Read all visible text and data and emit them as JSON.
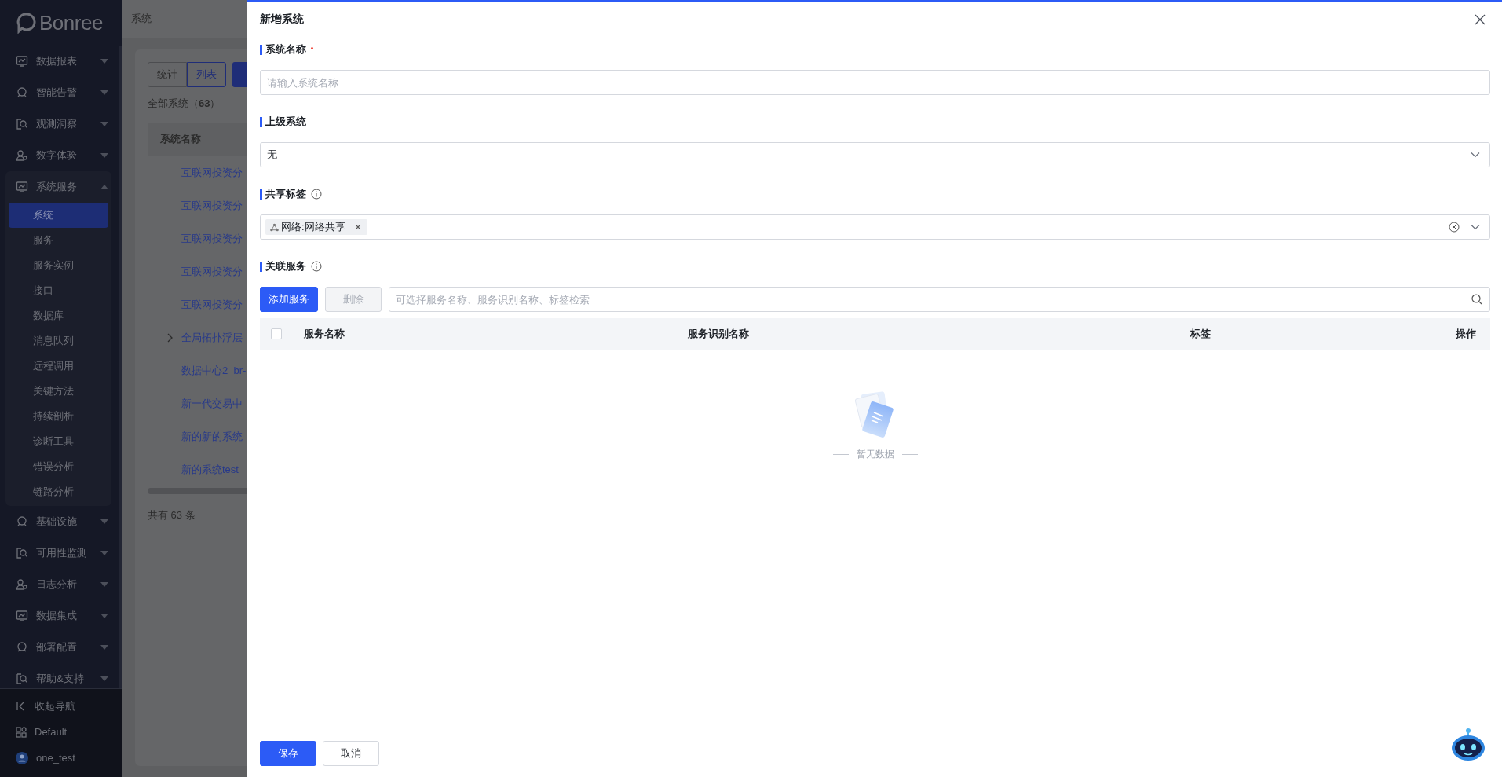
{
  "sidebar": {
    "logo": "Bonree",
    "menu": [
      {
        "label": "数据报表",
        "expanded": false
      },
      {
        "label": "智能告警",
        "expanded": false
      },
      {
        "label": "观测洞察",
        "expanded": false
      },
      {
        "label": "数字体验",
        "expanded": false
      },
      {
        "label": "系统服务",
        "expanded": true,
        "children": [
          {
            "label": "系统",
            "selected": true
          },
          {
            "label": "服务",
            "selected": false
          },
          {
            "label": "服务实例",
            "selected": false
          },
          {
            "label": "接口",
            "selected": false
          },
          {
            "label": "数据库",
            "selected": false
          },
          {
            "label": "消息队列",
            "selected": false
          },
          {
            "label": "远程调用",
            "selected": false
          },
          {
            "label": "关键方法",
            "selected": false
          },
          {
            "label": "持续剖析",
            "selected": false
          },
          {
            "label": "诊断工具",
            "selected": false
          },
          {
            "label": "错误分析",
            "selected": false
          },
          {
            "label": "链路分析",
            "selected": false
          }
        ]
      },
      {
        "label": "基础设施",
        "expanded": false
      },
      {
        "label": "可用性监测",
        "expanded": false
      },
      {
        "label": "日志分析",
        "expanded": false
      },
      {
        "label": "数据集成",
        "expanded": false
      },
      {
        "label": "部署配置",
        "expanded": false
      },
      {
        "label": "帮助&支持",
        "expanded": false
      }
    ],
    "footer": [
      "收起导航",
      "Default",
      "one_test"
    ]
  },
  "page": {
    "breadcrumb": "系统",
    "view_tabs": [
      {
        "label": "统计",
        "selected": false
      },
      {
        "label": "列表",
        "selected": true
      }
    ],
    "count": "全部系统（**63**）",
    "column": "系统名称",
    "rows": [
      {
        "name": "互联网投资分",
        "expandable": false
      },
      {
        "name": "互联网投资分",
        "expandable": false
      },
      {
        "name": "互联网投资分",
        "expandable": false
      },
      {
        "name": "互联网投资分",
        "expandable": false
      },
      {
        "name": "互联网投资分",
        "expandable": false
      },
      {
        "name": "全局拓扑浮层",
        "expandable": true
      },
      {
        "name": "数据中心2_br-",
        "expandable": false
      },
      {
        "name": "新一代交易中",
        "expandable": false
      },
      {
        "name": "新的新的系统",
        "expandable": false
      },
      {
        "name": "新的系统test",
        "expandable": false
      }
    ],
    "total": "共有 63 条"
  },
  "drawer": {
    "title": "新增系统",
    "fields": [
      {
        "kind": "text",
        "label": "系统名称",
        "required": true,
        "info": false,
        "placeholder": "请输入系统名称"
      },
      {
        "kind": "select",
        "label": "上级系统",
        "required": false,
        "info": false,
        "value": "无"
      },
      {
        "kind": "tags",
        "label": "共享标签",
        "required": false,
        "info": true,
        "tags": [
          "网络:网络共享"
        ]
      },
      {
        "kind": "services",
        "label": "关联服务",
        "required": false,
        "info": true,
        "add_button": "添加服务",
        "delete_button": {
          "label": "删除",
          "disabled": true
        },
        "search_placeholder": "可选择服务名称、服务识别名称、标签检索",
        "columns": [
          "服务名称",
          "服务识别名称",
          "标签",
          "操作"
        ],
        "select_all_checked": false,
        "empty_text": "暂无数据"
      }
    ],
    "buttons": [
      {
        "label": "保存",
        "kind": "primary"
      },
      {
        "label": "取消",
        "kind": "default"
      }
    ]
  }
}
